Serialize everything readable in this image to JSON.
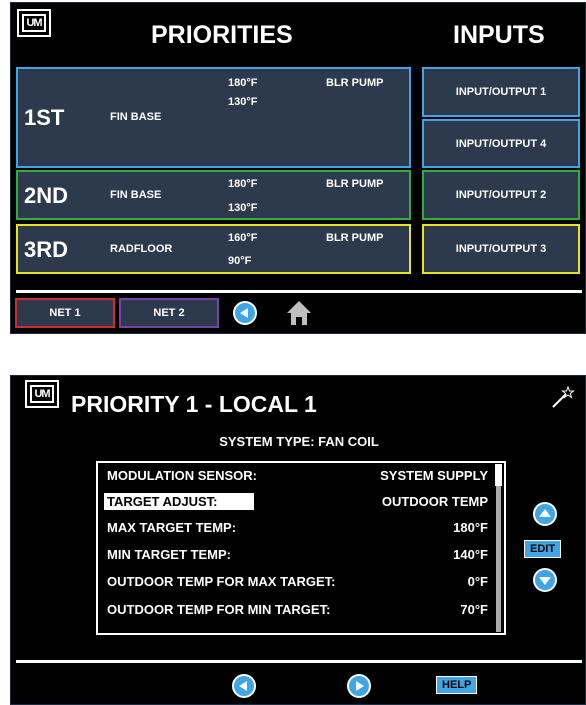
{
  "screen1": {
    "logo": "UM",
    "title": "PRIORITIES",
    "inputs_title": "INPUTS",
    "zones": [
      {
        "rank": "1ST",
        "name": "FIN BASE",
        "temp1": "180°F",
        "temp2": "130°F",
        "pump": "BLR PUMP",
        "color": "#3ea6e6"
      },
      {
        "rank": "2ND",
        "name": "FIN BASE",
        "temp1": "180°F",
        "temp2": "130°F",
        "pump": "BLR PUMP",
        "color": "#2fae3e"
      },
      {
        "rank": "3RD",
        "name": "RADFLOOR",
        "temp1": "160°F",
        "temp2": "90°F",
        "pump": "BLR PUMP",
        "color": "#e9e31d"
      }
    ],
    "io": [
      {
        "label": "INPUT/OUTPUT 1",
        "color": "#3ea6e6"
      },
      {
        "label": "INPUT/OUTPUT 4",
        "color": "#3ea6e6"
      },
      {
        "label": "INPUT/OUTPUT 2",
        "color": "#2fae3e"
      },
      {
        "label": "INPUT/OUTPUT 3",
        "color": "#e9e31d"
      }
    ],
    "nets": [
      {
        "label": "NET 1",
        "color": "#d42a2a"
      },
      {
        "label": "NET 2",
        "color": "#7b3fa8"
      }
    ]
  },
  "screen2": {
    "logo": "UM",
    "title": "PRIORITY 1 - LOCAL 1",
    "system_type": "SYSTEM TYPE: FAN COIL",
    "rows": [
      {
        "label": "MODULATION SENSOR:",
        "value": "SYSTEM SUPPLY"
      },
      {
        "label": "TARGET ADJUST:",
        "value": "OUTDOOR TEMP",
        "selected": true
      },
      {
        "label": "MAX TARGET TEMP:",
        "value": "180°F"
      },
      {
        "label": "MIN TARGET TEMP:",
        "value": "140°F"
      },
      {
        "label": "OUTDOOR TEMP FOR MAX TARGET:",
        "value": "0°F"
      },
      {
        "label": "OUTDOOR TEMP FOR MIN TARGET:",
        "value": "70°F"
      }
    ],
    "edit_label": "EDIT",
    "help_label": "HELP"
  },
  "colors": {
    "panel": "#2d3a4d",
    "accent": "#3ea6e6"
  }
}
